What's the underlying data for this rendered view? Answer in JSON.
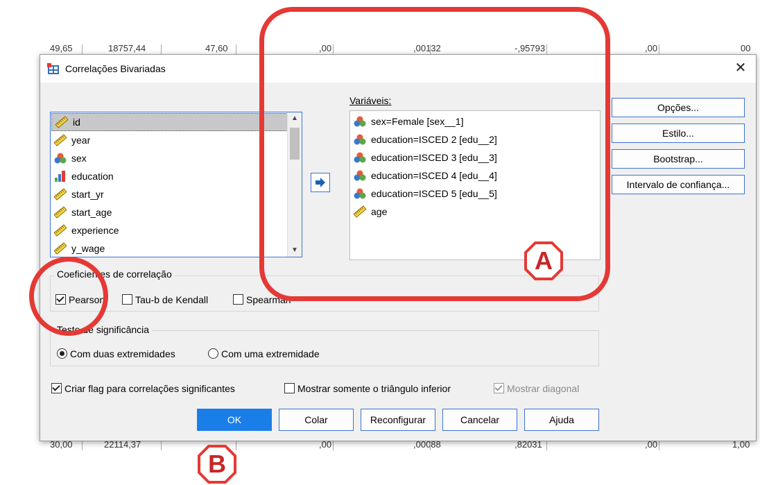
{
  "background_rows": {
    "top": [
      "49,65",
      "18757,44",
      "47,60",
      ",00",
      ",00132",
      "-,95793",
      ",00",
      "00"
    ],
    "bottom": [
      "30,00",
      "22114,37",
      "...,..",
      ",00",
      ",00088",
      ",82031",
      ",00",
      "1,00"
    ]
  },
  "dialog": {
    "title": "Correlações Bivariadas",
    "close_label": "✕"
  },
  "source_list": {
    "items": [
      {
        "label": "id",
        "icon": "scale-ruler-icon",
        "selected": true
      },
      {
        "label": "year",
        "icon": "scale-ruler-icon"
      },
      {
        "label": "sex",
        "icon": "nominal-icon"
      },
      {
        "label": "education",
        "icon": "ordinal-icon"
      },
      {
        "label": "start_yr",
        "icon": "scale-ruler-icon"
      },
      {
        "label": "start_age",
        "icon": "scale-ruler-icon"
      },
      {
        "label": "experience",
        "icon": "scale-ruler-icon"
      },
      {
        "label": "y_wage",
        "icon": "scale-ruler-icon"
      }
    ]
  },
  "target_list": {
    "label": "Variáveis:",
    "items": [
      {
        "label": "sex=Female [sex__1]",
        "icon": "nominal-icon"
      },
      {
        "label": "education=ISCED 2 [edu__2]",
        "icon": "nominal-icon"
      },
      {
        "label": "education=ISCED 3 [edu__3]",
        "icon": "nominal-icon"
      },
      {
        "label": "education=ISCED 4 [edu__4]",
        "icon": "nominal-icon"
      },
      {
        "label": "education=ISCED 5 [edu__5]",
        "icon": "nominal-icon"
      },
      {
        "label": "age",
        "icon": "scale-ruler-icon"
      }
    ]
  },
  "side_buttons": {
    "options": "Opções...",
    "style": "Estilo...",
    "bootstrap": "Bootstrap...",
    "confidence": "Intervalo de confiança..."
  },
  "coefficients": {
    "legend": "Coeficientes de correlação",
    "pearson": "Pearson",
    "kendall": "Tau-b de Kendall",
    "spearman": "Spearman",
    "pearson_checked": true,
    "kendall_checked": false,
    "spearman_checked": false
  },
  "significance": {
    "legend": "Teste de significância",
    "two_tailed": "Com duas extremidades",
    "one_tailed": "Com uma extremidade",
    "selected": "two_tailed"
  },
  "flags": {
    "flag_significant": "Criar flag para correlações significantes",
    "lower_triangle": "Mostrar somente o triângulo inferior",
    "show_diagonal": "Mostrar diagonal"
  },
  "buttons": {
    "ok": "OK",
    "paste": "Colar",
    "reset": "Reconfigurar",
    "cancel": "Cancelar",
    "help": "Ajuda"
  },
  "annotations": {
    "a": "A",
    "b": "B",
    "color": "#e53935"
  }
}
